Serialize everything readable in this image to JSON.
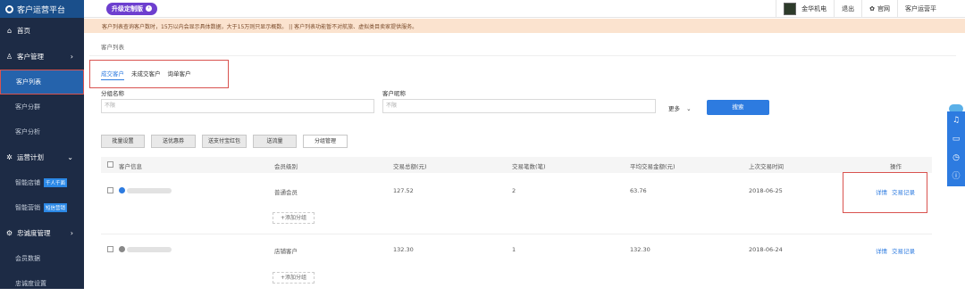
{
  "app": {
    "title": "客户运营平台"
  },
  "sidebar": {
    "items": [
      {
        "label": "首页"
      },
      {
        "label": "客户管理",
        "chevron": "›"
      },
      {
        "label": "客户列表"
      },
      {
        "label": "客户分群"
      },
      {
        "label": "客户分析"
      },
      {
        "label": "运营计划",
        "chevron": "⌄"
      },
      {
        "label": "智能店铺",
        "tag": "千人千面"
      },
      {
        "label": "智能营销",
        "tag": "短信营销"
      },
      {
        "label": "忠诚度管理",
        "chevron": "›"
      },
      {
        "label": "会员数据"
      },
      {
        "label": "忠诚度设置"
      }
    ]
  },
  "topbar": {
    "upgrade_label": "升级定制版",
    "shop_name": "金华机电",
    "logout": "退出",
    "official_site": "官网",
    "platform": "客户运营平"
  },
  "notice": "客户列表查询客户数时，15万以内会显示具体数据，大于15万则只显示概数。 || 客户列表功能暂不对航旅、虚拟类目卖家提供服务。",
  "breadcrumb": "客户列表",
  "tabs": [
    {
      "label": "成交客户"
    },
    {
      "label": "未成交客户"
    },
    {
      "label": "询单客户"
    }
  ],
  "filters": {
    "group_label": "分组名称",
    "group_placeholder": "不限",
    "nickname_label": "客户昵称",
    "nickname_placeholder": "不限",
    "more_label": "更多",
    "search_label": "搜索"
  },
  "actions": [
    "批量设置",
    "送优惠券",
    "送支付宝红包",
    "送流量",
    "分组管理"
  ],
  "table": {
    "headers": [
      "客户信息",
      "会员级别",
      "交易总额(元)",
      "交易笔数(笔)",
      "平均交易金额(元)",
      "上次交易时间",
      "操作"
    ],
    "rows": [
      {
        "level": "普通会员",
        "total": "127.52",
        "count": "2",
        "avg": "63.76",
        "last": "2018-06-25",
        "detail": "详情",
        "records": "交易记录",
        "add_group": "+添加分组",
        "dot_color": "#2d7be0"
      },
      {
        "level": "店铺客户",
        "total": "132.30",
        "count": "1",
        "avg": "132.30",
        "last": "2018-06-24",
        "detail": "详情",
        "records": "交易记录",
        "add_group": "+添加分组",
        "dot_color": "#888888"
      }
    ]
  },
  "colors": {
    "sidebar_bg": "#1d2b45",
    "accent": "#2d7be0",
    "highlight": "#d9534f",
    "notice_bg": "#fbe3cf"
  },
  "icons": {
    "home": "home-icon",
    "customer": "user-icon",
    "plan": "sun-icon",
    "loyalty": "gear-icon"
  }
}
